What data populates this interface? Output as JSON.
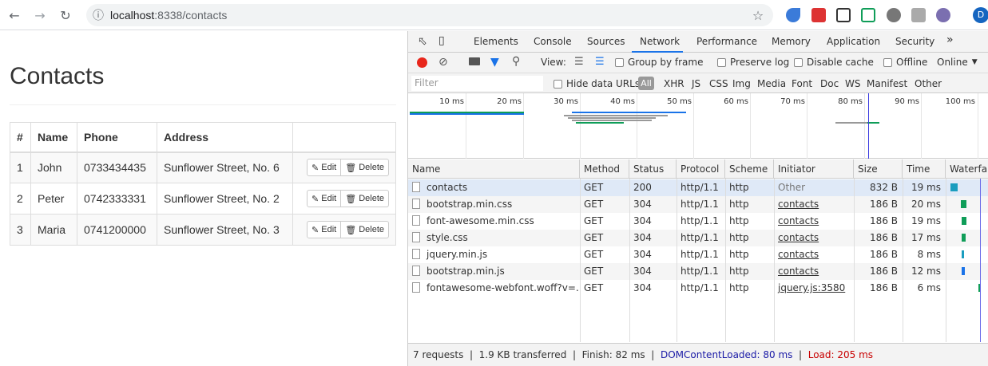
{
  "browser": {
    "url_host": "localhost",
    "url_port": ":8338",
    "url_path": "/contacts",
    "profile_initial": "D"
  },
  "page": {
    "title": "Contacts",
    "table": {
      "headers": [
        "#",
        "Name",
        "Phone",
        "Address"
      ],
      "rows": [
        {
          "id": "1",
          "name": "John",
          "phone": "0733434435",
          "address": "Sunflower Street, No. 6"
        },
        {
          "id": "2",
          "name": "Peter",
          "phone": "0742333331",
          "address": "Sunflower Street, No. 2"
        },
        {
          "id": "3",
          "name": "Maria",
          "phone": "0741200000",
          "address": "Sunflower Street, No. 3"
        }
      ],
      "edit_label": "Edit",
      "delete_label": "Delete"
    }
  },
  "devtools": {
    "tabs": [
      "Elements",
      "Console",
      "Sources",
      "Network",
      "Performance",
      "Memory",
      "Application",
      "Security"
    ],
    "active_tab": "Network",
    "more_tabs": "»",
    "controls": {
      "view_label": "View:",
      "group_by_frame": "Group by frame",
      "preserve_log": "Preserve log",
      "disable_cache": "Disable cache",
      "offline": "Offline",
      "throttle": "Online"
    },
    "filter": {
      "placeholder": "Filter",
      "hide_data_urls": "Hide data URLs",
      "all": "All",
      "types": [
        "XHR",
        "JS",
        "CSS",
        "Img",
        "Media",
        "Font",
        "Doc",
        "WS",
        "Manifest",
        "Other"
      ]
    },
    "overview_ticks": [
      "10 ms",
      "20 ms",
      "30 ms",
      "40 ms",
      "50 ms",
      "60 ms",
      "70 ms",
      "80 ms",
      "90 ms",
      "100 ms"
    ],
    "columns": [
      "Name",
      "Method",
      "Status",
      "Protocol",
      "Scheme",
      "Initiator",
      "Size",
      "Time",
      "Waterfall"
    ],
    "requests": [
      {
        "name": "contacts",
        "method": "GET",
        "status": "200",
        "protocol": "http/1.1",
        "scheme": "http",
        "initiator": "Other",
        "size": "832 B",
        "time": "19 ms",
        "link": false
      },
      {
        "name": "bootstrap.min.css",
        "method": "GET",
        "status": "304",
        "protocol": "http/1.1",
        "scheme": "http",
        "initiator": "contacts",
        "size": "186 B",
        "time": "20 ms",
        "link": true
      },
      {
        "name": "font-awesome.min.css",
        "method": "GET",
        "status": "304",
        "protocol": "http/1.1",
        "scheme": "http",
        "initiator": "contacts",
        "size": "186 B",
        "time": "19 ms",
        "link": true
      },
      {
        "name": "style.css",
        "method": "GET",
        "status": "304",
        "protocol": "http/1.1",
        "scheme": "http",
        "initiator": "contacts",
        "size": "186 B",
        "time": "17 ms",
        "link": true
      },
      {
        "name": "jquery.min.js",
        "method": "GET",
        "status": "304",
        "protocol": "http/1.1",
        "scheme": "http",
        "initiator": "contacts",
        "size": "186 B",
        "time": "8 ms",
        "link": true
      },
      {
        "name": "bootstrap.min.js",
        "method": "GET",
        "status": "304",
        "protocol": "http/1.1",
        "scheme": "http",
        "initiator": "contacts",
        "size": "186 B",
        "time": "12 ms",
        "link": true
      },
      {
        "name": "fontawesome-webfont.woff?v=…",
        "method": "GET",
        "status": "304",
        "protocol": "http/1.1",
        "scheme": "http",
        "initiator": "jquery.js:3580",
        "size": "186 B",
        "time": "6 ms",
        "link": true
      }
    ],
    "summary": {
      "requests": "7 requests",
      "transferred": "1.9 KB transferred",
      "finish": "Finish: 82 ms",
      "dom_content_loaded": "DOMContentLoaded: 80 ms",
      "load": "Load: 205 ms"
    }
  }
}
